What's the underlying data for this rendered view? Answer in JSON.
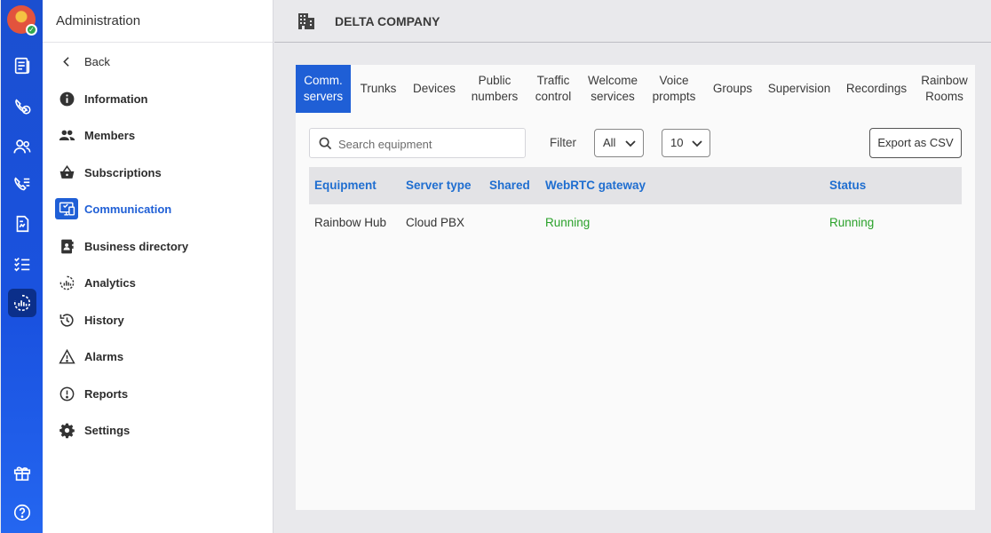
{
  "rail": {
    "items": [
      {
        "icon": "directory-icon"
      },
      {
        "icon": "phone-clock-icon"
      },
      {
        "icon": "users-icon"
      },
      {
        "icon": "call-list-icon"
      },
      {
        "icon": "document-icon"
      },
      {
        "icon": "checklist-icon"
      },
      {
        "icon": "analytics-icon",
        "active": true
      }
    ],
    "bottom": [
      {
        "icon": "gift-icon"
      },
      {
        "icon": "help-icon"
      }
    ]
  },
  "sidebar": {
    "title": "Administration",
    "items": [
      {
        "label": "Back",
        "icon": "chevron-left-icon"
      },
      {
        "label": "Information",
        "icon": "info-icon"
      },
      {
        "label": "Members",
        "icon": "members-icon"
      },
      {
        "label": "Subscriptions",
        "icon": "basket-icon"
      },
      {
        "label": "Communication",
        "icon": "communication-icon",
        "active": true
      },
      {
        "label": "Business directory",
        "icon": "contact-book-icon"
      },
      {
        "label": "Analytics",
        "icon": "analytics-icon"
      },
      {
        "label": "History",
        "icon": "history-icon"
      },
      {
        "label": "Alarms",
        "icon": "alarm-triangle-icon"
      },
      {
        "label": "Reports",
        "icon": "report-icon"
      },
      {
        "label": "Settings",
        "icon": "gear-icon"
      }
    ]
  },
  "header": {
    "company": "DELTA COMPANY",
    "icon": "building-icon"
  },
  "tabs": [
    {
      "label": "Comm.\nservers",
      "active": true
    },
    {
      "label": "Trunks"
    },
    {
      "label": "Devices"
    },
    {
      "label": "Public\nnumbers"
    },
    {
      "label": "Traffic\ncontrol"
    },
    {
      "label": "Welcome\nservices"
    },
    {
      "label": "Voice\nprompts"
    },
    {
      "label": "Groups"
    },
    {
      "label": "Supervision"
    },
    {
      "label": "Recordings"
    },
    {
      "label": "Rainbow\nRooms"
    }
  ],
  "toolbar": {
    "search_placeholder": "Search equipment",
    "filter_label": "Filter",
    "filter_value": "All",
    "page_size": "10",
    "export_label": "Export as CSV"
  },
  "table": {
    "columns": [
      "Equipment",
      "Server type",
      "Shared",
      "WebRTC gateway",
      "Status"
    ],
    "rows": [
      [
        "Rainbow Hub",
        "Cloud PBX",
        "",
        "Running",
        "Running"
      ]
    ]
  },
  "colors": {
    "accent": "#1f5fd6",
    "link": "#1f6ed0",
    "running": "#2aa12a",
    "rail": "#1b4fd0"
  }
}
